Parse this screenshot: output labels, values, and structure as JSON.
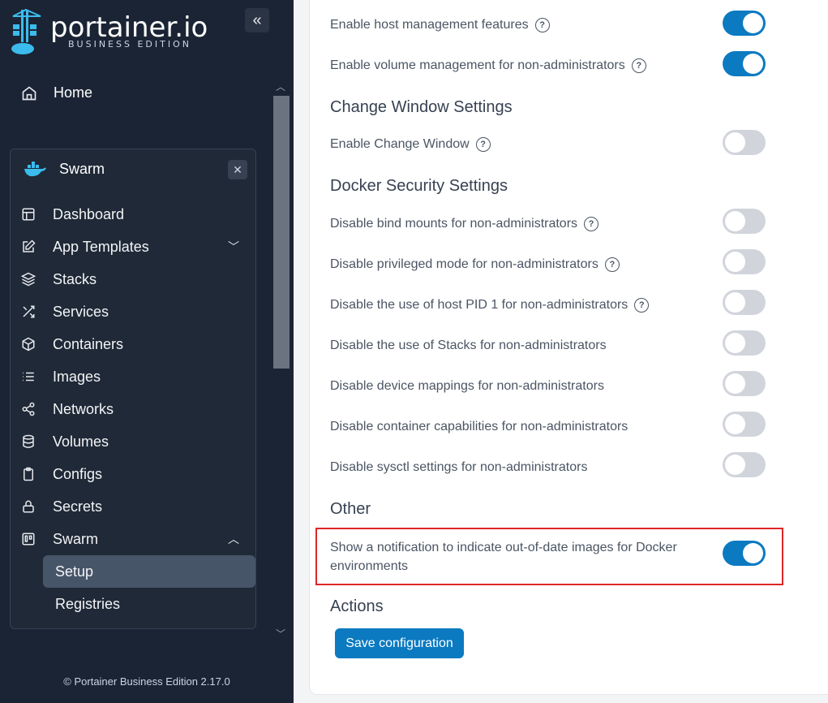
{
  "brand": {
    "name": "portainer.io",
    "edition": "BUSINESS EDITION"
  },
  "sidebar": {
    "home_label": "Home",
    "environment": {
      "name": "Swarm"
    },
    "items": [
      {
        "label": "Dashboard",
        "icon": "dashboard-icon"
      },
      {
        "label": "App Templates",
        "icon": "edit-icon"
      },
      {
        "label": "Stacks",
        "icon": "layers-icon"
      },
      {
        "label": "Services",
        "icon": "shuffle-icon"
      },
      {
        "label": "Containers",
        "icon": "box-icon"
      },
      {
        "label": "Images",
        "icon": "list-icon"
      },
      {
        "label": "Networks",
        "icon": "share-icon"
      },
      {
        "label": "Volumes",
        "icon": "database-icon"
      },
      {
        "label": "Configs",
        "icon": "clipboard-icon"
      },
      {
        "label": "Secrets",
        "icon": "lock-icon"
      },
      {
        "label": "Swarm",
        "icon": "trello-icon"
      }
    ],
    "swarm_sub": [
      {
        "label": "Setup"
      },
      {
        "label": "Registries"
      }
    ],
    "footer": "© Portainer Business Edition  2.17.0"
  },
  "settings": {
    "host_mgmt": {
      "label": "Enable host management features",
      "on": true
    },
    "volume_mgmt": {
      "label": "Enable volume management for non-administrators",
      "on": true
    },
    "change_window_title": "Change Window Settings",
    "change_window": {
      "label": "Enable Change Window",
      "on": false
    },
    "docker_security_title": "Docker Security Settings",
    "bind_mounts": {
      "label": "Disable bind mounts for non-administrators",
      "on": false
    },
    "privileged": {
      "label": "Disable privileged mode for non-administrators",
      "on": false
    },
    "host_pid": {
      "label": "Disable the use of host PID 1 for non-administrators",
      "on": false
    },
    "stacks": {
      "label": "Disable the use of Stacks for non-administrators",
      "on": false
    },
    "device_mappings": {
      "label": "Disable device mappings for non-administrators",
      "on": false
    },
    "capabilities": {
      "label": "Disable container capabilities for non-administrators",
      "on": false
    },
    "sysctl": {
      "label": "Disable sysctl settings for non-administrators",
      "on": false
    },
    "other_title": "Other",
    "notification": {
      "label": "Show a notification to indicate out-of-date images for Docker environments",
      "on": true
    },
    "actions_title": "Actions",
    "save_label": "Save configuration"
  },
  "colors": {
    "accent": "#0b7ac1",
    "sidebar_bg": "#1b2434",
    "highlight": "#dc2626"
  }
}
